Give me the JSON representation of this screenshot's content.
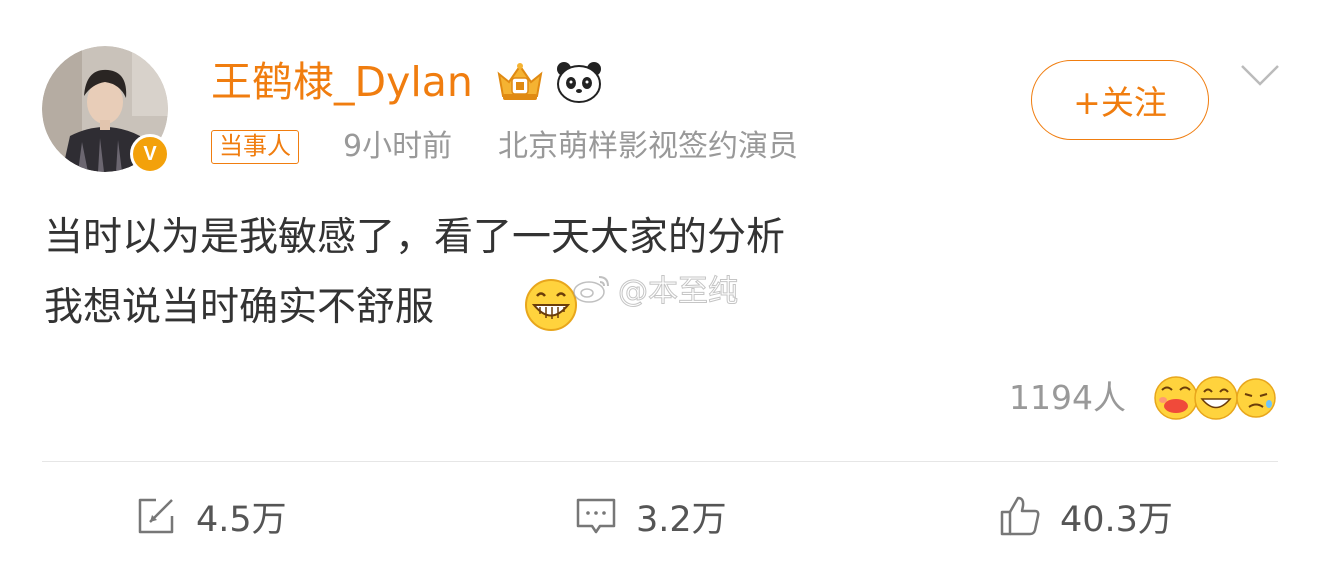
{
  "user": {
    "name": "王鹤棣_Dylan",
    "verified_badge": "V"
  },
  "meta": {
    "tag": "当事人",
    "time": "9小时前",
    "source": "北京萌样影视签约演员"
  },
  "follow_button": "+关注",
  "post": {
    "line1": "当时以为是我敏感了，看了一天大家的分析",
    "line2": "我想说当时确实不舒服"
  },
  "watermark": "@本至纯",
  "reactions": {
    "count": "1194人"
  },
  "actions": {
    "repost": "4.5万",
    "comment": "3.2万",
    "like": "40.3万"
  },
  "colors": {
    "accent": "#f07d0f",
    "meta_text": "#999999",
    "body_text": "#333333"
  },
  "icons": [
    "crown-icon",
    "panda-icon",
    "chevron-down-icon",
    "grin-emoji-icon",
    "weibo-logo-icon",
    "repost-icon",
    "comment-icon",
    "like-icon"
  ]
}
